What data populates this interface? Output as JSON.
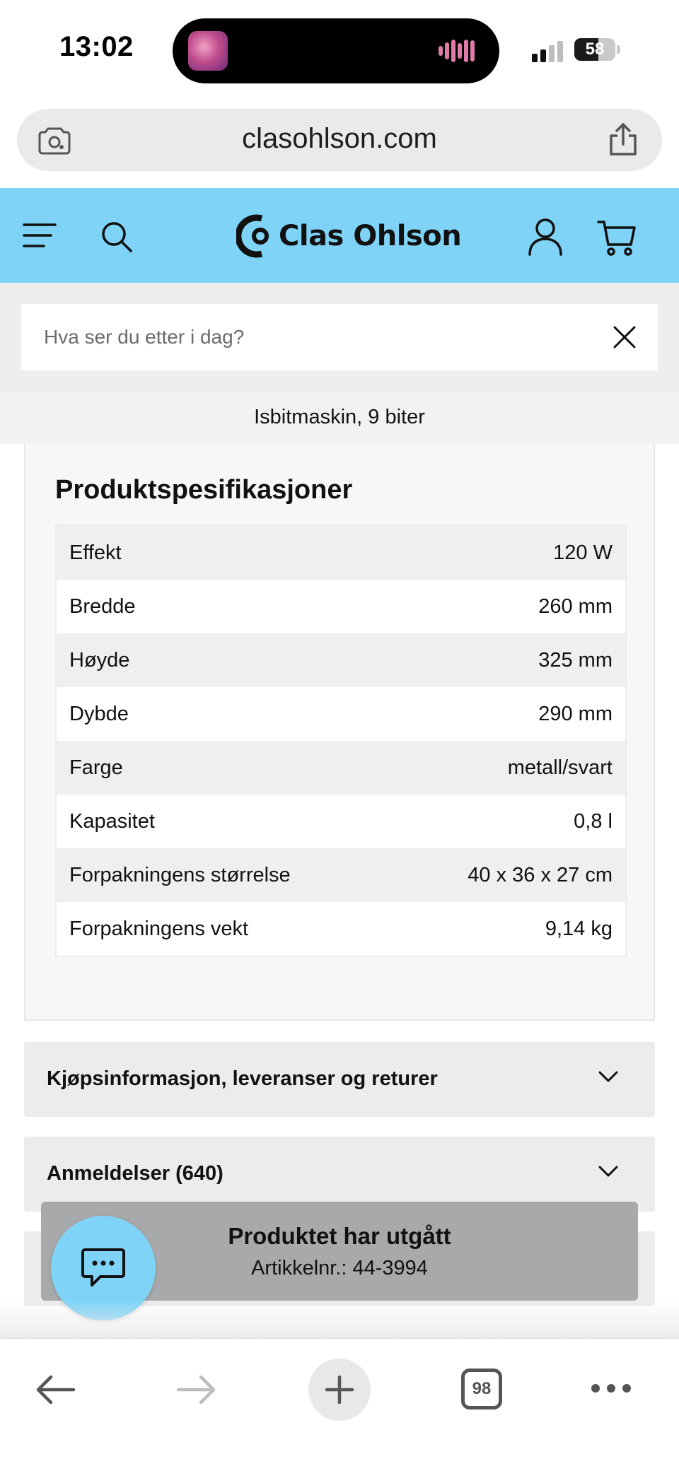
{
  "status_bar": {
    "time": "13:02",
    "battery_level": "58",
    "battery_fraction": 0.58
  },
  "browser": {
    "url": "clasohlson.com",
    "open_tabs": "98"
  },
  "site": {
    "brand": "Clas Ohlson",
    "accent_color": "#7fd3f7",
    "search": {
      "placeholder": "Hva ser du etter i dag?",
      "value": ""
    },
    "product_name": "Isbitmaskin, 9 biter"
  },
  "specs": {
    "title": "Produktspesifikasjoner",
    "rows": [
      {
        "label": "Effekt",
        "value": "120 W"
      },
      {
        "label": "Bredde",
        "value": "260 mm"
      },
      {
        "label": "Høyde",
        "value": "325 mm"
      },
      {
        "label": "Dybde",
        "value": "290 mm"
      },
      {
        "label": "Farge",
        "value": "metall/svart"
      },
      {
        "label": "Kapasitet",
        "value": "0,8 l"
      },
      {
        "label": "Forpakningens størrelse",
        "value": "40 x 36 x 27 cm"
      },
      {
        "label": "Forpakningens vekt",
        "value": "9,14  kg"
      }
    ]
  },
  "accordions": [
    {
      "label": "Kjøpsinformasjon, leveranser og returer"
    },
    {
      "label": "Anmeldelser (640)"
    }
  ],
  "toast": {
    "title": "Produktet har utgått",
    "subtitle": "Artikkelnr.:  44-3994"
  },
  "icons": {
    "menu": "hamburger-menu-icon",
    "search": "search-icon",
    "account": "user-icon",
    "cart": "cart-icon",
    "close": "close-icon",
    "chat": "chat-icon",
    "back": "arrow-left-icon",
    "forward": "arrow-right-icon",
    "new_tab": "plus-icon",
    "more": "more-icon"
  }
}
